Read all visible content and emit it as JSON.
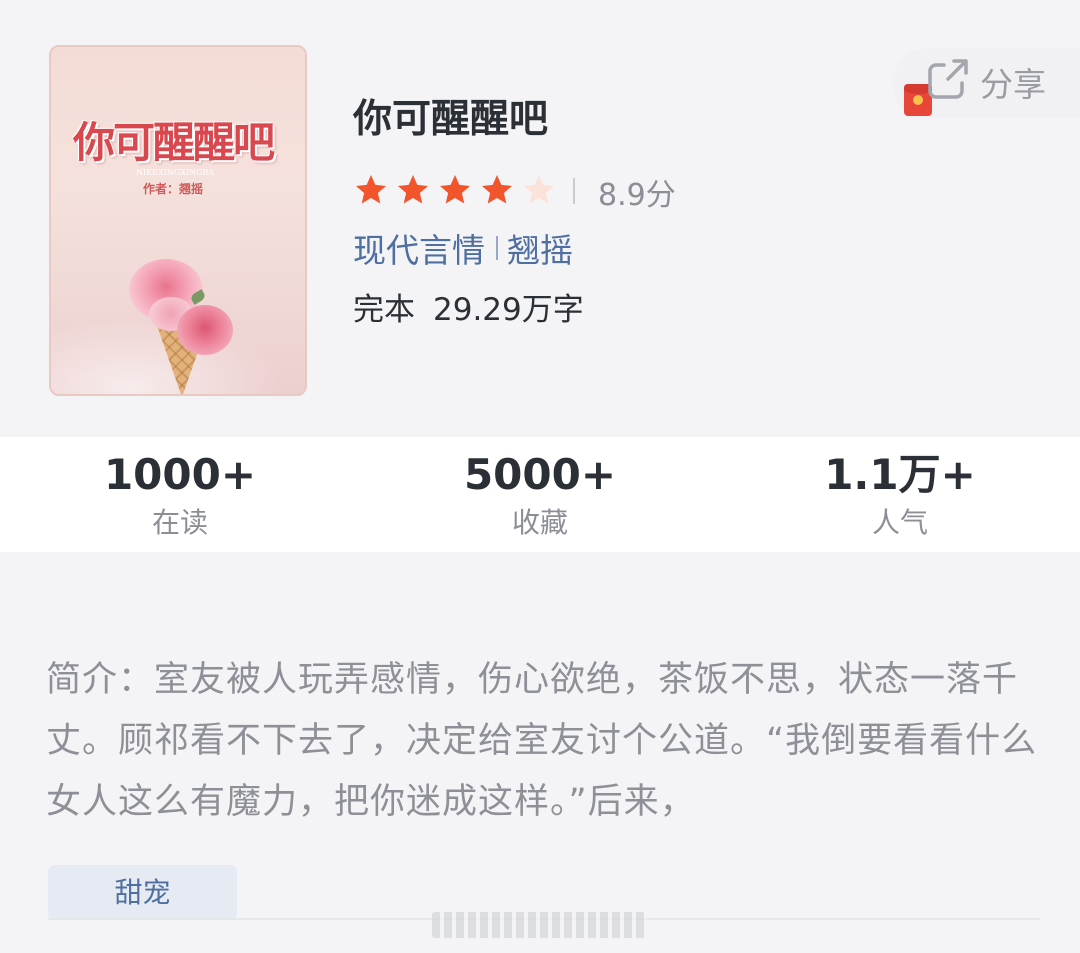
{
  "book": {
    "cover": {
      "title": "你可醒醒吧",
      "pinyin": "NIKEXINGXINGBA",
      "author_line": "作者：翘摇"
    },
    "title": "你可醒醒吧",
    "rating": {
      "stars_filled": 4,
      "stars_total": 5,
      "score_text": "8.9分"
    },
    "category": "现代言情",
    "author": "翘摇",
    "status": "完本",
    "word_count": "29.29万字"
  },
  "share": {
    "label": "分享",
    "icon": "share-icon",
    "badge_icon": "red-packet-icon"
  },
  "stats": [
    {
      "value": "1000+",
      "label": "在读"
    },
    {
      "value": "5000+",
      "label": "收藏"
    },
    {
      "value": "1.1万+",
      "label": "人气"
    }
  ],
  "intro": {
    "text": "简介：室友被人玩弄感情，伤心欲绝，茶饭不思，状态一落千丈。顾祁看不下去了，决定给室友讨个公道。“我倒要看看什么女人这么有魔力，把你迷成这样。”后来，"
  },
  "tags": [
    "甜宠"
  ],
  "colors": {
    "star_filled": "#f2552c",
    "star_empty": "#fbe3dc",
    "link_blue": "#4f6fa0",
    "text_dark": "#2b2f36",
    "text_gray": "#8e9097"
  }
}
